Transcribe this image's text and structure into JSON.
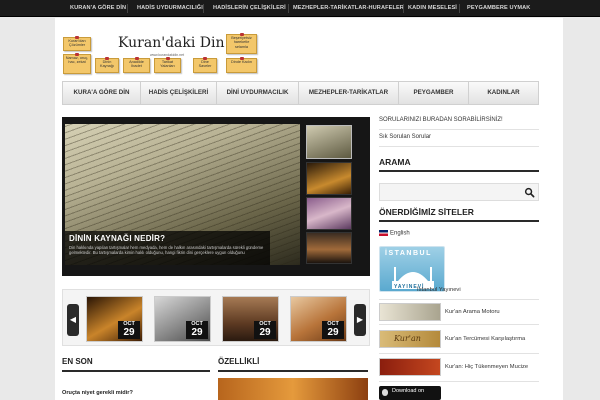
{
  "topnav": {
    "items": [
      {
        "label": "KURAN'A GÖRE DİN"
      },
      {
        "label": "HADİS UYDURMACILIĞI"
      },
      {
        "label": "HADİSLERİN ÇELİŞKİLERİ"
      },
      {
        "label": "MEZHEPLER-TARİKATLAR-HURAFELER"
      },
      {
        "label": "KADIN MESELESİ"
      },
      {
        "label": "PEYGAMBERE UYMAK"
      }
    ]
  },
  "logo": {
    "title": "Kuran'daki Din",
    "url": "www.kurandakidin.net",
    "notes": [
      {
        "text": "Kuran'dan Çözümler"
      },
      {
        "text": "Namaz, oruç, hac, zekat"
      },
      {
        "text": "Dinin Kaynağı"
      },
      {
        "text": "Anadilde İbadet"
      },
      {
        "text": "Tarikat Yalanları"
      },
      {
        "text": "Dine Saveler"
      },
      {
        "text": "Beşeriyetsiz hareketle selamla"
      },
      {
        "text": "Dinde Kadın"
      }
    ]
  },
  "mainnav": {
    "items": [
      {
        "label": "KURA'A GÖRE DİN"
      },
      {
        "label": "HADİS ÇELİŞKİLERİ"
      },
      {
        "label": "DİNİ UYDURMACILIK"
      },
      {
        "label": "MEZHEPLER-TARİKATLAR"
      },
      {
        "label": "PEYGAMBER"
      },
      {
        "label": "KADINLAR"
      }
    ]
  },
  "slider": {
    "title": "DİNİN KAYNAĞI NEDİR?",
    "text": "Din hakkında yapılan tartışmalar hem medyada, hem de halkın arasındaki tartışmalarda sürekli gündeme gelmektedir. Bu tartışmalarda kimin haklı olduğunu, hangi fikrin dini gerçeklere uygun olduğunu"
  },
  "carousel": {
    "prev_label": "◀",
    "next_label": "▶",
    "items": [
      {
        "month": "OCT",
        "day": "29"
      },
      {
        "month": "OCT",
        "day": "29"
      },
      {
        "month": "OCT",
        "day": "29"
      },
      {
        "month": "OCT",
        "day": "29"
      }
    ]
  },
  "sections": {
    "latest": "EN SON",
    "featured": "ÖZELLİKLİ",
    "latest_first": "Oruçta niyet gerekli midir?"
  },
  "sidebar": {
    "link1": "SORULARINIZI BURADAN SORABİLİRSİNİZ!",
    "link2": "Sık Sorulan Sorular",
    "search_heading": "ARAMA",
    "search_placeholder": "",
    "sites_heading": "ÖNERDİĞİMİZ SİTELER",
    "english": "English",
    "sites": [
      {
        "label": "İstanbul Yayınevi"
      },
      {
        "label": "Kur'an Arama Motoru"
      },
      {
        "label": "Kur'an Tercümesi Karşılaştırma"
      },
      {
        "label": "Kur'an: Hiç Tükenmeyen Mucize"
      }
    ],
    "istanbul_logo": "İSTANBUL",
    "istanbul_logo_sub": "YAYINEVİ",
    "banner_kuran": "Kur'an",
    "download_label": "Download on"
  }
}
